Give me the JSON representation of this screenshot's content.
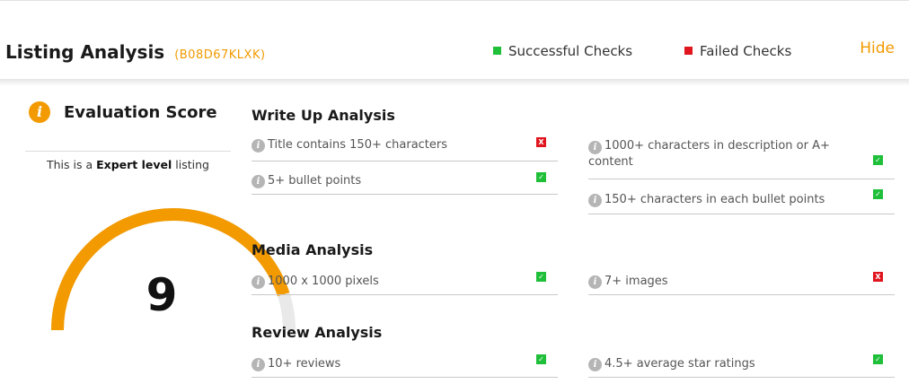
{
  "header": {
    "title": "Listing Analysis",
    "asin": "(B08D67KLXK)",
    "legend_success": "Successful Checks",
    "legend_failed": "Failed Checks",
    "hide_label": "Hide"
  },
  "score": {
    "title": "Evaluation Score",
    "level_prefix": "This is a",
    "level": "Expert level",
    "level_suffix": "listing",
    "value": "9",
    "gauge_fraction": 0.9,
    "colors": {
      "fill": "#f29a00",
      "track": "#e9e9e9"
    }
  },
  "sections": {
    "write_up": {
      "title": "Write Up Analysis",
      "checks": [
        {
          "label": "Title contains 150+ characters",
          "status": "fail",
          "mark": "X"
        },
        {
          "label": "5+ bullet points",
          "status": "pass",
          "mark": "✓"
        },
        {
          "label": "1000+ characters in description or A+ content",
          "status": "pass",
          "mark": "✓"
        },
        {
          "label": "150+ characters in each bullet points",
          "status": "pass",
          "mark": "✓"
        }
      ]
    },
    "media": {
      "title": "Media Analysis",
      "checks": [
        {
          "label": "1000 x 1000 pixels",
          "status": "pass",
          "mark": "✓"
        },
        {
          "label": "7+ images",
          "status": "fail",
          "mark": "X"
        }
      ]
    },
    "review": {
      "title": "Review Analysis",
      "checks": [
        {
          "label": "10+ reviews",
          "status": "pass",
          "mark": "✓"
        },
        {
          "label": "4.5+ average star ratings",
          "status": "pass",
          "mark": "✓"
        }
      ]
    }
  },
  "icons": {
    "info": "i"
  },
  "colors": {
    "accent": "#f29a00",
    "pass": "#1fbf3a",
    "fail": "#e0151e"
  }
}
